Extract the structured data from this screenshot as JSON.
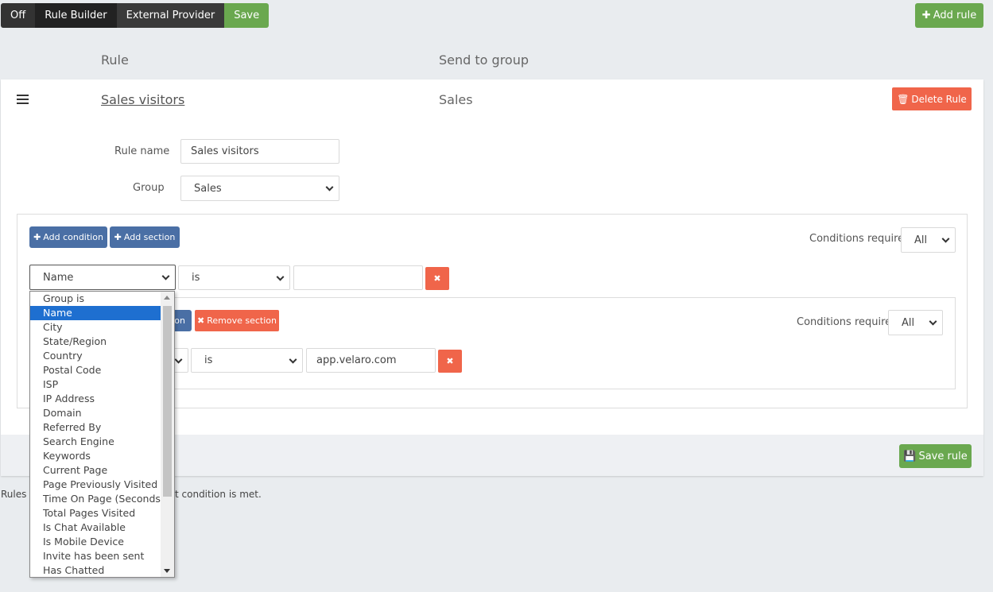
{
  "toolbar": {
    "mode_off": "Off",
    "mode_rule_builder": "Rule Builder",
    "mode_external": "External Provider",
    "save": "Save",
    "add_rule": "Add rule"
  },
  "columns": {
    "rule": "Rule",
    "group": "Send to group"
  },
  "rule": {
    "name_link": "Sales visitors",
    "group_value": "Sales",
    "delete": "Delete Rule",
    "rule_name_label": "Rule name",
    "rule_name_value": "Sales visitors",
    "group_label": "Group",
    "group_select": "Sales",
    "save_rule": "Save rule"
  },
  "builder": {
    "add_condition": "Add condition",
    "add_section": "Add section",
    "conditions_required_label": "Conditions required",
    "conditions_required_value": "All",
    "condition1": {
      "field": "Name",
      "operator": "is",
      "value": ""
    },
    "section": {
      "add_condition_partial": "on",
      "remove_section": "Remove section",
      "conditions_required_label": "Conditions required",
      "conditions_required_value": "All",
      "operator": "is",
      "value": "app.velaro.com"
    }
  },
  "dropdown": {
    "selected_index": 1,
    "options": [
      "Group is",
      "Name",
      "City",
      "State/Region",
      "Country",
      "Postal Code",
      "ISP",
      "IP Address",
      "Domain",
      "Referred By",
      "Search Engine",
      "Keywords",
      "Current Page",
      "Page Previously Visited",
      "Time On Page (Seconds)",
      "Total Pages Visited",
      "Is Chat Available",
      "Is Mobile Device",
      "Invite has been sent",
      "Has Chatted"
    ]
  },
  "footer": {
    "note_start": "Rules e",
    "note_end": "t condition is met."
  },
  "colors": {
    "green": "#6aa84f",
    "red": "#f0654a",
    "blue": "#4a6fa5",
    "selected": "#1e6fd0"
  }
}
